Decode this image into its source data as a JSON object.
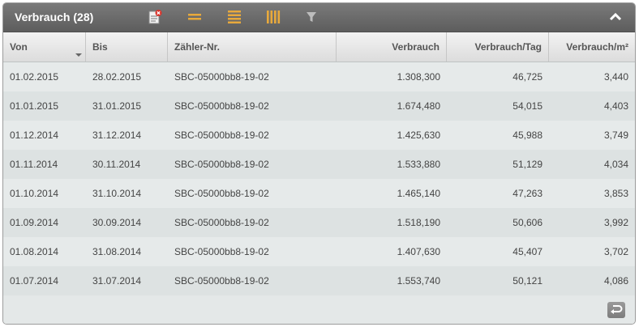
{
  "panel": {
    "title": "Verbrauch (28)",
    "toolbar": [
      {
        "name": "export-document-icon"
      },
      {
        "name": "compact-rows-icon"
      },
      {
        "name": "expanded-rows-icon"
      },
      {
        "name": "columns-icon"
      },
      {
        "name": "filter-icon"
      }
    ],
    "collapse_icon": "chevron-up-icon"
  },
  "table": {
    "headers": [
      "Von",
      "Bis",
      "Zähler-Nr.",
      "Verbrauch",
      "Verbrauch/Tag",
      "Verbrauch/m²"
    ],
    "rows": [
      [
        "01.02.2015",
        "28.02.2015",
        "SBC-05000bb8-19-02",
        "1.308,300",
        "46,725",
        "3,440"
      ],
      [
        "01.01.2015",
        "31.01.2015",
        "SBC-05000bb8-19-02",
        "1.674,480",
        "54,015",
        "4,403"
      ],
      [
        "01.12.2014",
        "31.12.2014",
        "SBC-05000bb8-19-02",
        "1.425,630",
        "45,988",
        "3,749"
      ],
      [
        "01.11.2014",
        "30.11.2014",
        "SBC-05000bb8-19-02",
        "1.533,880",
        "51,129",
        "4,034"
      ],
      [
        "01.10.2014",
        "31.10.2014",
        "SBC-05000bb8-19-02",
        "1.465,140",
        "47,263",
        "3,853"
      ],
      [
        "01.09.2014",
        "30.09.2014",
        "SBC-05000bb8-19-02",
        "1.518,190",
        "50,606",
        "3,992"
      ],
      [
        "01.08.2014",
        "31.08.2014",
        "SBC-05000bb8-19-02",
        "1.407,630",
        "45,407",
        "3,702"
      ],
      [
        "01.07.2014",
        "31.07.2014",
        "SBC-05000bb8-19-02",
        "1.553,740",
        "50,121",
        "4,086"
      ]
    ]
  },
  "footer": {
    "undo_icon": "undo-icon"
  },
  "colors": {
    "accent_bars": "#e8a93c",
    "titlebar": "#6b6b6b"
  }
}
